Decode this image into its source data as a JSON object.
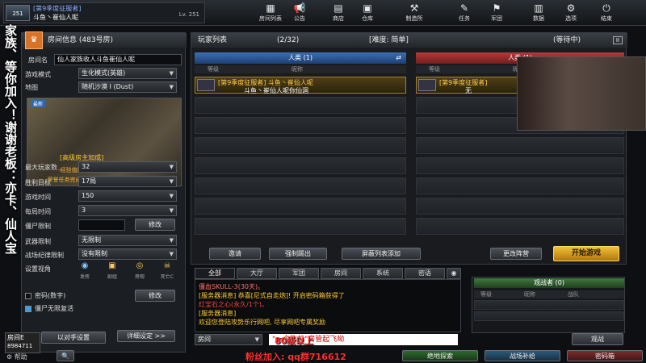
{
  "player": {
    "title": "[第9季度征服者]",
    "name": "斗鱼丶崔仙人呢",
    "level": "Lv. 251",
    "rank": "251"
  },
  "topnav": [
    {
      "label": "房间列表",
      "icon": "▦"
    },
    {
      "label": "公告",
      "icon": "📢"
    },
    {
      "label": "商店",
      "icon": "▤"
    },
    {
      "label": "仓库",
      "icon": "▣"
    },
    {
      "label": "制造所",
      "icon": "⚒"
    },
    {
      "label": "任务",
      "icon": "✎"
    },
    {
      "label": "军团",
      "icon": "⚑"
    },
    {
      "label": "数据",
      "icon": "▥"
    },
    {
      "label": "选项",
      "icon": "⚙"
    },
    {
      "label": "结束",
      "icon": "⏻"
    }
  ],
  "room": {
    "header": "房间信息 (483号房)",
    "name_label": "房间名",
    "name": "仙人家族收人斗鱼崔仙人呢",
    "mode_label": "游戏模式",
    "mode": "生化模式(英雄)",
    "map_label": "地图",
    "map": "随机沙漠 I (Dust)",
    "map_new": "最新",
    "ad1": "[高级房主加成]",
    "ad2": "-经验值提升50%",
    "ad3": "-荣誉任务完成速度提升50%",
    "max_label": "最大玩家数",
    "max": "32",
    "win_label": "胜利目标",
    "win": "17局",
    "time_label": "游戏时间",
    "time": "150",
    "round_label": "每局时间",
    "round": "3",
    "zombie_label": "僵尸限制",
    "modify": "修改",
    "weapon_label": "武器限制",
    "weapon": "无限制",
    "disc_label": "战场纪律限制",
    "disc": "没有限制",
    "view_label": "设置视角",
    "views": [
      "发挥",
      "剧组",
      "旁观",
      "死亡C"
    ],
    "pw_label": "密码(数字)",
    "modify2": "修改",
    "revive_label": "僵尸无限复活",
    "room_tag": "房间E",
    "uid": "8984711",
    "help": "帮助",
    "opponent": "以对手设置",
    "detail": "详细设定 >>"
  },
  "list": {
    "header": "玩家列表",
    "count": "(2/32)",
    "difficulty": "[难度: 简单]",
    "status": "(等待中)",
    "team_a": "人类 (1)",
    "team_b": "人类 (1)",
    "col_rank": "等级",
    "col_name": "昵称",
    "slot_a_title": "[第9季度征服者] 斗鱼丶崔仙人呢",
    "slot_a_sub": "斗鱼丶崔仙人呢你仙涸",
    "slot_b_title": "[第9季度征服者]",
    "slot_b_sub": "无",
    "invite": "邀请",
    "kick": "强制踢出",
    "block": "屏蔽列表添加",
    "change": "更改阵营",
    "start": "开始游戏"
  },
  "tabs": [
    "全部",
    "大厅",
    "军团",
    "房间",
    "系统",
    "密语"
  ],
  "chat": [
    {
      "text": "僵血SKULL-3(30天)。",
      "color": "#ff6b6b"
    },
    {
      "text": "[服务器消息] 恭喜[尼式自走炮]! 开启密码箱获得了",
      "color": "#ffcc33"
    },
    {
      "text": "红宝石之心(永久/1个)。",
      "color": "#ff4040"
    },
    {
      "text": "[服务器消息]",
      "color": "#ffcc33"
    },
    {
      "text": "欢迎您登陆攻势乐行网吧, 尽享网吧专属奖励",
      "color": "#ffcc33"
    }
  ],
  "chat_input": {
    "channel": "房间",
    "text": "\"一个飞机\"房管起飞呦"
  },
  "spec": {
    "header": "观战者 (0)",
    "col_rank": "等级",
    "col_name": "昵称",
    "col_clan": "战队",
    "btn": "观战"
  },
  "bottom": {
    "b1": "绝地探索",
    "b2": "战场补给",
    "b3": "密码箱"
  },
  "overlay_left": "家族、等你加入！谢谢老板：亦卡、仙人宝",
  "stream_msg": "80级以上",
  "stream_msg2": "粉丝加入: qq群716612"
}
